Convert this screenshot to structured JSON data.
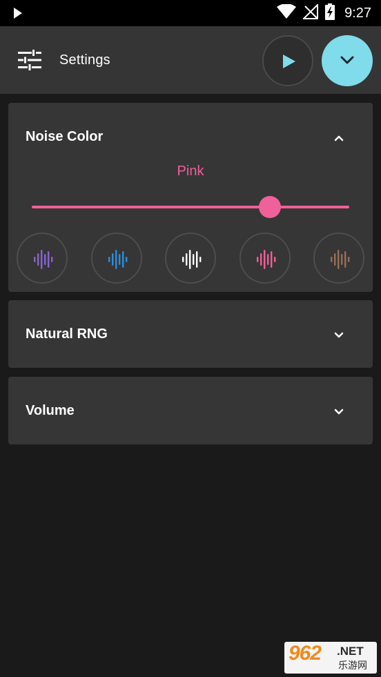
{
  "status_bar": {
    "time": "9:27",
    "icons": [
      "play-notification-icon",
      "wifi-icon",
      "no-signal-icon",
      "battery-charging-icon"
    ]
  },
  "app_bar": {
    "title": "Settings",
    "icons": {
      "menu": "settings-sliders-icon",
      "play": "play-icon",
      "collapse": "chevron-down-icon"
    },
    "accent_color": "#80dbea"
  },
  "noise_color": {
    "title": "Noise Color",
    "expanded": true,
    "value": "Pink",
    "slider_fraction": 0.75,
    "accent_color": "#f0609a",
    "options": [
      {
        "name": "violet",
        "icon": "waveform-icon",
        "color": "#8a63d2"
      },
      {
        "name": "blue",
        "icon": "waveform-icon",
        "color": "#2b8ee0"
      },
      {
        "name": "white",
        "icon": "waveform-icon",
        "color": "#ffffff"
      },
      {
        "name": "pink",
        "icon": "waveform-icon",
        "color": "#f0609a"
      },
      {
        "name": "brown",
        "icon": "waveform-icon",
        "color": "#9b6e57"
      }
    ]
  },
  "natural_rng": {
    "title": "Natural RNG",
    "expanded": false
  },
  "volume": {
    "title": "Volume",
    "expanded": false
  },
  "watermark": {
    "number": "962",
    "suffix": ".NET",
    "chinese": "乐游网"
  }
}
